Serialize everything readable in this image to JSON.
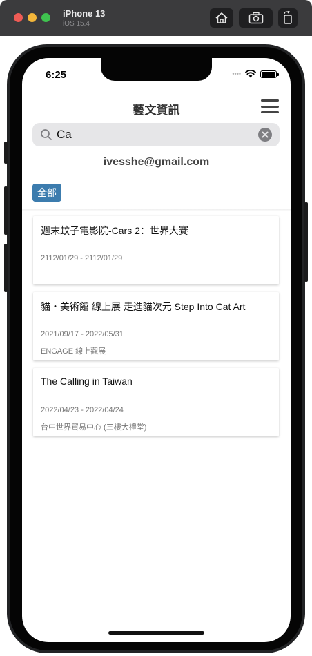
{
  "simulator": {
    "device": "iPhone 13",
    "os": "iOS 15.4",
    "buttons": [
      "home",
      "screenshot",
      "rotate"
    ]
  },
  "status_bar": {
    "time": "6:25",
    "signal": "••••"
  },
  "header": {
    "title": "藝文資訊",
    "menu_icon": "hamburger-icon"
  },
  "search": {
    "value": "Ca",
    "placeholder": ""
  },
  "account": {
    "email": "ivesshe@gmail.com"
  },
  "filters": {
    "selected": "全部"
  },
  "events": [
    {
      "title": "週末蚊子電影院-Cars 2：世界大賽",
      "date": "2112/01/29 - 2112/01/29",
      "location": ""
    },
    {
      "title": "貓・美術館 線上展 走進貓次元 Step Into Cat Art",
      "date": "2021/09/17 - 2022/05/31",
      "location": "ENGAGE 線上觀展"
    },
    {
      "title": "The Calling in Taiwan",
      "date": "2022/04/23 - 2022/04/24",
      "location": "台中世界貿易中心 (三樓大禮堂)"
    }
  ],
  "colors": {
    "chip": "#3c7cae",
    "search_bg": "#e6e6e8",
    "title": "#333333"
  }
}
